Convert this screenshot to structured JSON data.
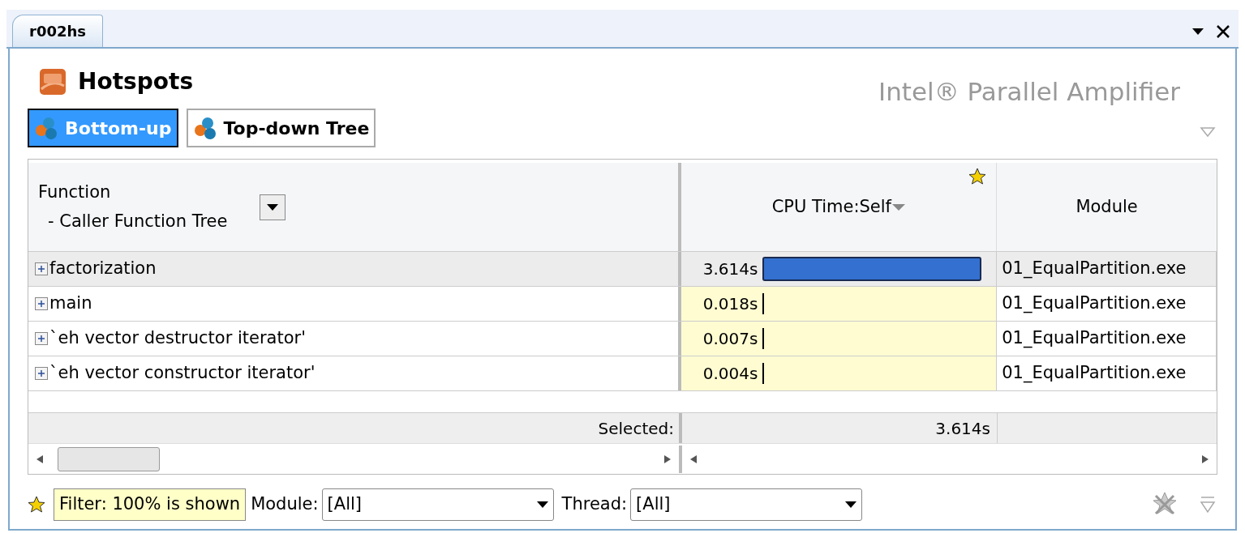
{
  "document_tab": {
    "label": "r002hs",
    "selected": true
  },
  "header": {
    "title": "Hotspots",
    "brand": "Intel® Parallel Amplifier"
  },
  "views": [
    {
      "label": "Bottom-up",
      "selected": true
    },
    {
      "label": "Top-down Tree",
      "selected": false
    }
  ],
  "table": {
    "columns": [
      {
        "label": "Function",
        "sublabel": "- Caller Function Tree"
      },
      {
        "label": "CPU Time:Self"
      },
      {
        "label": "Module"
      }
    ],
    "rows": [
      {
        "function": "factorization",
        "cpu_time": "3.614s",
        "kind": "bar",
        "module": "01_EqualPartition.exe",
        "selected": true
      },
      {
        "function": "main",
        "cpu_time": "0.018s",
        "kind": "tick",
        "module": "01_EqualPartition.exe",
        "selected": false
      },
      {
        "function": "`eh vector destructor iterator'",
        "cpu_time": "0.007s",
        "kind": "tick",
        "module": "01_EqualPartition.exe",
        "selected": false
      },
      {
        "function": "`eh vector constructor iterator'",
        "cpu_time": "0.004s",
        "kind": "tick",
        "module": "01_EqualPartition.exe",
        "selected": false
      }
    ],
    "summary": {
      "label": "Selected:",
      "cpu_time": "3.614s"
    }
  },
  "filter_bar": {
    "filter": "Filter: 100% is shown",
    "module_label": "Module:",
    "module_value": "[All]",
    "thread_label": "Thread:",
    "thread_value": "[All]"
  }
}
